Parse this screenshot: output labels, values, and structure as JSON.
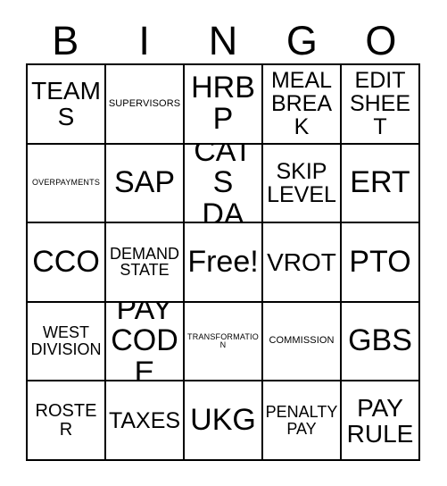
{
  "card": {
    "title": "BINGO",
    "free_space_label": "Free!",
    "ink_color": "#000000",
    "background_color": "#ffffff",
    "columns": 5,
    "rows": 5
  },
  "header": {
    "letters": [
      {
        "label": "B"
      },
      {
        "label": "I"
      },
      {
        "label": "N"
      },
      {
        "label": "G"
      },
      {
        "label": "O"
      }
    ]
  },
  "grid": {
    "cells": [
      {
        "label": "TEAMS",
        "size": "xl",
        "free": false
      },
      {
        "label": "SUPERVISORS",
        "size": "xs",
        "free": false
      },
      {
        "label": "HRBP",
        "size": "xxl",
        "free": false
      },
      {
        "label": "MEAL\nBREAK",
        "size": "l",
        "free": false
      },
      {
        "label": "EDIT\nSHEET",
        "size": "l",
        "free": false
      },
      {
        "label": "OVERPAYMENTS",
        "size": "xxs",
        "free": false
      },
      {
        "label": "SAP",
        "size": "xxl",
        "free": false
      },
      {
        "label": "CATS\nDA",
        "size": "xxl",
        "free": false
      },
      {
        "label": "SKIP\nLEVEL",
        "size": "l",
        "free": false
      },
      {
        "label": "ERT",
        "size": "xxl",
        "free": false
      },
      {
        "label": "CCO",
        "size": "xxl",
        "free": false
      },
      {
        "label": "DEMAND\nSTATE",
        "size": "m",
        "free": false
      },
      {
        "label": "Free!",
        "size": "xxl",
        "free": true
      },
      {
        "label": "VROT",
        "size": "xl",
        "free": false
      },
      {
        "label": "PTO",
        "size": "xxl",
        "free": false
      },
      {
        "label": "WEST\nDIVISION",
        "size": "m",
        "free": false
      },
      {
        "label": "PAY\nCODE",
        "size": "xxl",
        "free": false
      },
      {
        "label": "TRANSFORMATION",
        "size": "xxs",
        "free": false
      },
      {
        "label": "COMMISSION",
        "size": "xs",
        "free": false
      },
      {
        "label": "GBS",
        "size": "xxl",
        "free": false
      },
      {
        "label": "ROSTER",
        "size": "ml",
        "free": false
      },
      {
        "label": "TAXES",
        "size": "l",
        "free": false
      },
      {
        "label": "UKG",
        "size": "xxl",
        "free": false
      },
      {
        "label": "PENALTY\nPAY",
        "size": "m",
        "free": false
      },
      {
        "label": "PAY\nRULE",
        "size": "xl",
        "free": false
      }
    ]
  }
}
